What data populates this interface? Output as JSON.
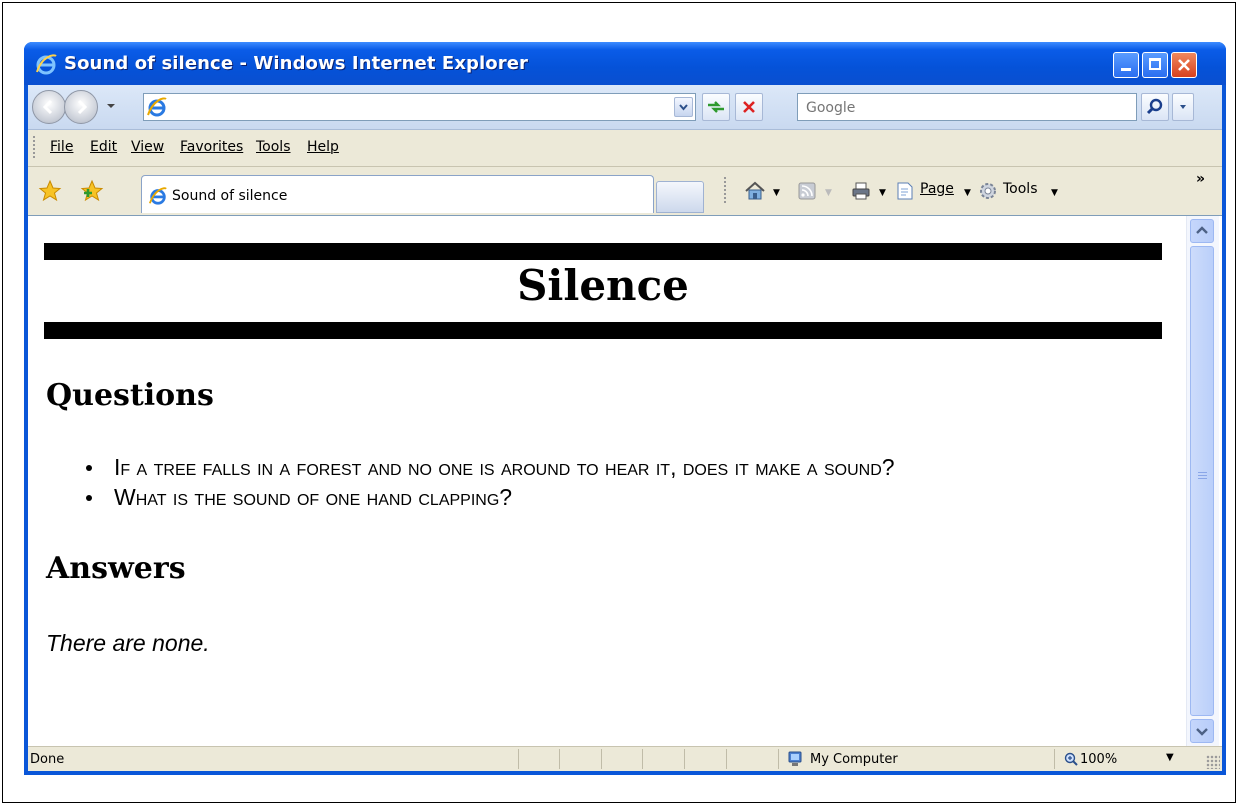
{
  "window": {
    "title": "Sound of silence - Windows Internet Explorer"
  },
  "navbar": {
    "address_value": "",
    "search_placeholder": "Google"
  },
  "menu": {
    "items": [
      "File",
      "Edit",
      "View",
      "Favorites",
      "Tools",
      "Help"
    ]
  },
  "commandbar": {
    "tab_label": "Sound of silence",
    "page_label": "Page",
    "tools_label": "Tools",
    "more_glyph": "»"
  },
  "page": {
    "title": "Silence",
    "questions_heading": "Questions",
    "questions": [
      "If a tree falls in a forest and no one is around to hear it, does it make a sound?",
      "What is the sound of one hand clapping?"
    ],
    "answers_heading": "Answers",
    "answer_text": "There are none."
  },
  "statusbar": {
    "status": "Done",
    "zone": "My Computer",
    "zoom": "100%"
  },
  "colors": {
    "titlebar": "#0a56d8",
    "close_button": "#d8401e",
    "scrollbar": "#bacffa"
  }
}
